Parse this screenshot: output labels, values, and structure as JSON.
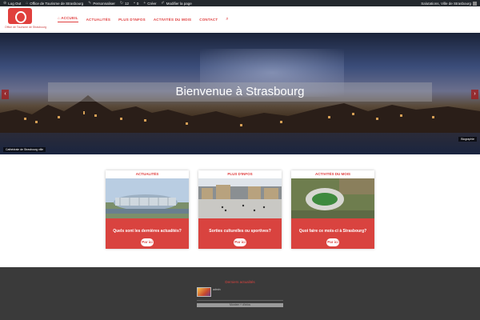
{
  "adminbar": {
    "items": [
      {
        "icon": "wordpress-icon",
        "label": "Log Out"
      },
      {
        "icon": "home-icon",
        "label": "Office de Tourisme de Strasbourg"
      },
      {
        "icon": "brush-icon",
        "label": "Personnaliser"
      },
      {
        "icon": "comment-icon",
        "label": "12"
      },
      {
        "icon": "bubble-icon",
        "label": "0"
      },
      {
        "icon": "plus-icon",
        "label": "Créer"
      },
      {
        "icon": "edit-icon",
        "label": "Modifier la page"
      }
    ],
    "greeting": "Salutations, Ville de Strasbourg"
  },
  "header": {
    "logo_text": "Office de Tourisme de Strasbourg",
    "nav": [
      {
        "label": "Accueil",
        "active": true
      },
      {
        "label": "Actualités",
        "active": false
      },
      {
        "label": "Plus d'infos",
        "active": false
      },
      {
        "label": "Activités du mois",
        "active": false
      },
      {
        "label": "Contact",
        "active": false
      }
    ]
  },
  "hero": {
    "title": "Bienvenue à Strasbourg",
    "caption": "Cathédrale de Strasbourg ville",
    "toggle_label": "Biographie",
    "prev_icon": "chevron-left-icon",
    "next_icon": "chevron-right-icon"
  },
  "cards": [
    {
      "heading": "Actualités",
      "text": "Quels sont les dernières actualités?",
      "button": "Par ici",
      "image": "modern-building-riverside"
    },
    {
      "heading": "Plus d'infos",
      "text": "Sorties culturelles ou sportives?",
      "button": "Par ici",
      "image": "city-square-crowd"
    },
    {
      "heading": "Activités du mois",
      "text": "Quoi faire ce mois-ci à Strasbourg?",
      "button": "Par ici",
      "image": "stadium-aerial"
    }
  ],
  "footer": {
    "title": "Derniers actualités",
    "meta": "admin",
    "button": "Montrer + d'infos"
  },
  "colors": {
    "brand": "#e04040",
    "adminbar": "#23282d",
    "footer": "#3a3a3a"
  }
}
